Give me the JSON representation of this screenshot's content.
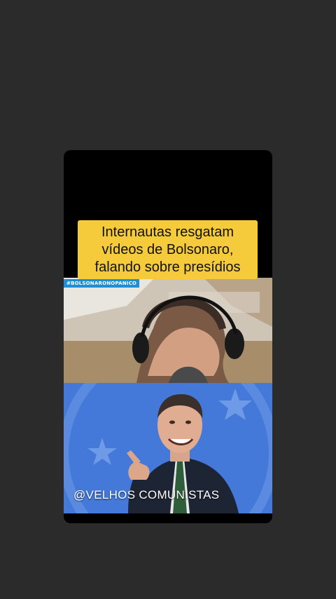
{
  "headline": {
    "line1": "Internautas resgatam",
    "line2": "vídeos de Bolsonaro,",
    "line3": "falando sobre presídios"
  },
  "clip_top": {
    "hashtag": "#BOLSONARONOPANICO",
    "description": "man wearing headphones speaking into camera"
  },
  "clip_bottom": {
    "description": "smiling man in suit pointing at camera"
  },
  "watermark": "@VELHOS COMUNISTAS",
  "colors": {
    "background": "#2b2b2b",
    "headline_bg": "#f5cb3c",
    "hashtag_bg": "#1d8fd6",
    "bottom_bg": "#3f72d6"
  }
}
